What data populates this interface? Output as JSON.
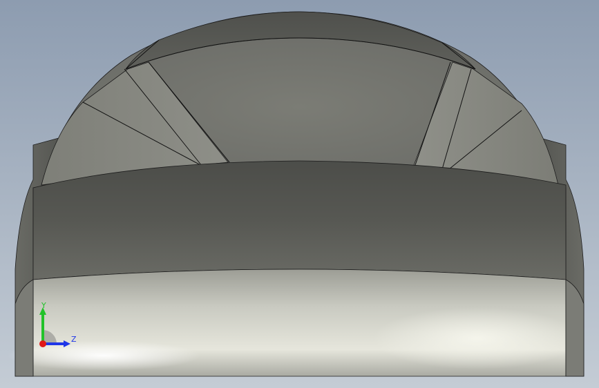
{
  "viewport": {
    "background_top": "#8d9cb0",
    "background_bottom": "#c4ccd5"
  },
  "triad": {
    "y_label": "Y",
    "z_label": "Z",
    "y_color": "#22c22a",
    "z_color": "#1f36e8",
    "x_color": "#e01818"
  }
}
